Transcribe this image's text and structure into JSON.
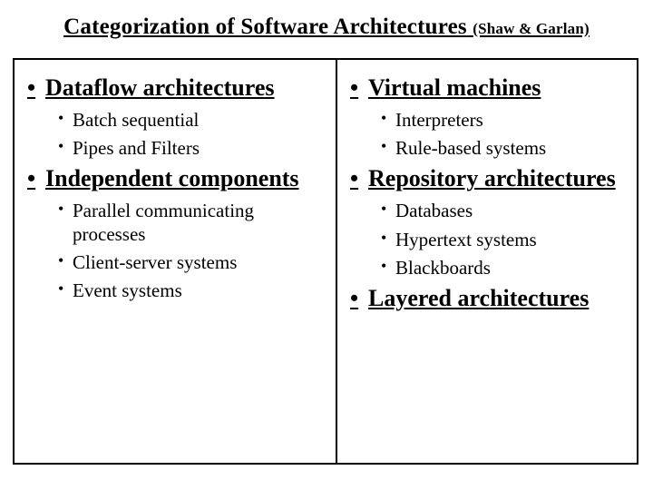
{
  "title": {
    "main": "Categorization of Software Architectures",
    "attribution": "(Shaw & Garlan)"
  },
  "left": {
    "categories": [
      {
        "name": "Dataflow architectures",
        "items": [
          "Batch sequential",
          "Pipes and Filters"
        ]
      },
      {
        "name": "Independent components",
        "items": [
          "Parallel communicating processes",
          "Client-server systems",
          "Event systems"
        ]
      }
    ]
  },
  "right": {
    "categories": [
      {
        "name": "Virtual machines",
        "items": [
          "Interpreters",
          "Rule-based systems"
        ]
      },
      {
        "name": "Repository architectures",
        "items": [
          "Databases",
          "Hypertext systems",
          "Blackboards"
        ]
      },
      {
        "name": "Layered architectures",
        "items": []
      }
    ]
  }
}
